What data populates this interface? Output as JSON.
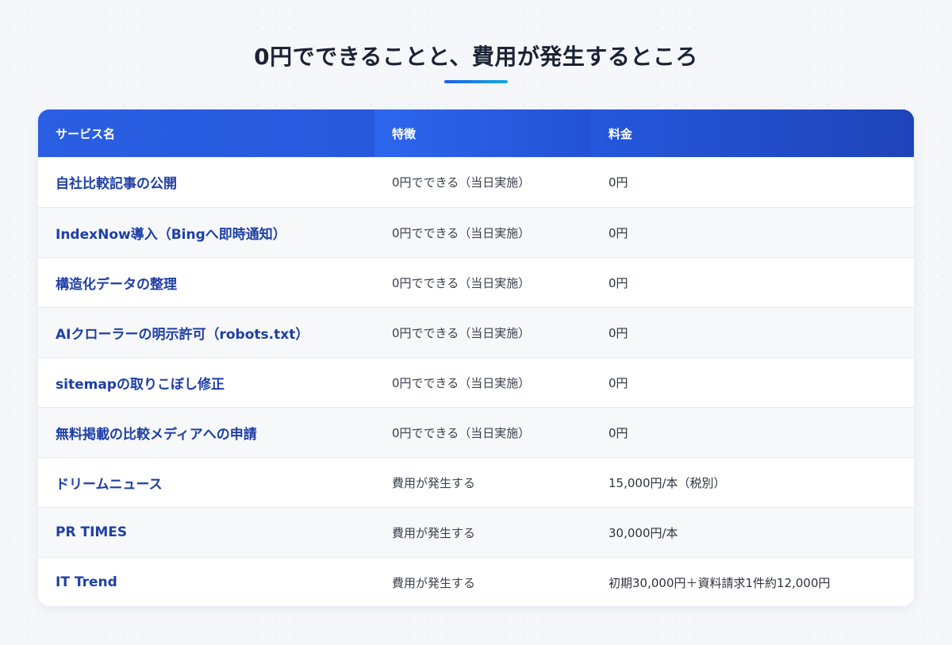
{
  "page": {
    "title": "0円でできることと、費用が発生するところ"
  },
  "colors": {
    "header_gradient_start": "#2a5fe3",
    "header_gradient_end": "#1f45bd",
    "service_name_text": "#1e3fa6",
    "underline_start": "#1e5eea",
    "underline_end": "#16a8e0"
  },
  "table": {
    "headers": [
      "サービス名",
      "特徴",
      "料金"
    ],
    "rows": [
      [
        "自社比較記事の公開",
        "0円でできる（当日実施）",
        "0円"
      ],
      [
        "IndexNow導入（Bingへ即時通知）",
        "0円でできる（当日実施）",
        "0円"
      ],
      [
        "構造化データの整理",
        "0円でできる（当日実施）",
        "0円"
      ],
      [
        "AIクローラーの明示許可（robots.txt）",
        "0円でできる（当日実施）",
        "0円"
      ],
      [
        "sitemapの取りこぼし修正",
        "0円でできる（当日実施）",
        "0円"
      ],
      [
        "無料掲載の比較メディアへの申請",
        "0円でできる（当日実施）",
        "0円"
      ],
      [
        "ドリームニュース",
        "費用が発生する",
        "15,000円/本（税別）"
      ],
      [
        "PR TIMES",
        "費用が発生する",
        "30,000円/本"
      ],
      [
        "IT Trend",
        "費用が発生する",
        "初期30,000円＋資料請求1件約12,000円"
      ]
    ]
  }
}
